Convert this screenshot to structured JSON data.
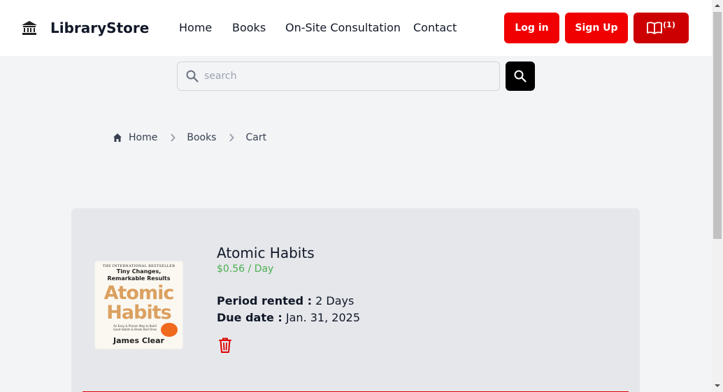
{
  "nav": {
    "brand": "LibraryStore",
    "links": [
      "Home",
      "Books",
      "On-Site Consultation",
      "Contact"
    ],
    "login_label": "Log in",
    "signup_label": "Sign Up",
    "cart_count": "(1)",
    "accent_color": "#f00000"
  },
  "search": {
    "placeholder": "search",
    "value": "",
    "icon": "search-icon"
  },
  "breadcrumb": [
    "Home",
    "Books",
    "Cart"
  ],
  "cart": {
    "items": [
      {
        "title": "Atomic Habits",
        "price": "$0.56 / Day",
        "period_label": "Period rented :",
        "period_value": "2 Days",
        "due_label": "Due date :",
        "due_value": "Jan. 31, 2025",
        "cover": {
          "top": "THE INTERNATIONAL BESTSELLER",
          "subtitle_1": "Tiny Changes,",
          "subtitle_2": "Remarkable Results",
          "title_1": "Atomic",
          "title_2": "Habits",
          "blurb": "An Easy & Proven Way to Build Good Habits & Break Bad Ones",
          "author": "James Clear"
        }
      }
    ]
  }
}
